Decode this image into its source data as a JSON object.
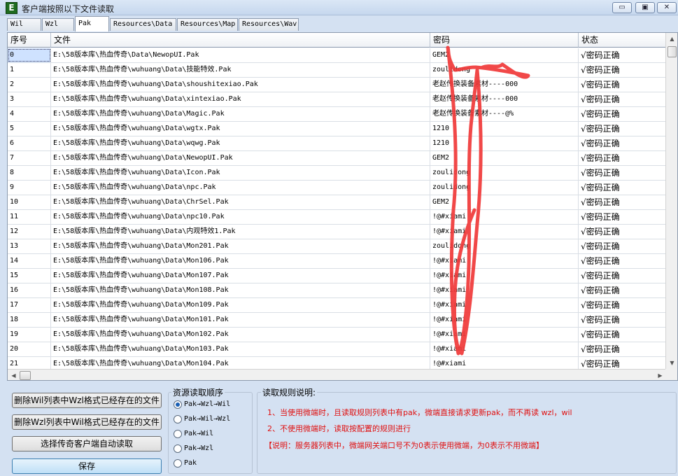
{
  "window": {
    "icon_letter": "E",
    "title": "客户端按照以下文件读取",
    "min_label": "▭",
    "max_label": "▣",
    "close_label": "✕"
  },
  "tabs": [
    {
      "label": "Wil",
      "active": false
    },
    {
      "label": "Wzl",
      "active": false
    },
    {
      "label": "Pak",
      "active": true
    },
    {
      "label": "Resources\\Data",
      "active": false
    },
    {
      "label": "Resources\\Map",
      "active": false
    },
    {
      "label": "Resources\\Wav",
      "active": false
    }
  ],
  "grid": {
    "headers": [
      "序号",
      "文件",
      "密码",
      "状态"
    ],
    "rows": [
      {
        "idx": "0",
        "file": "E:\\58版本库\\热血传奇\\Data\\NewopUI.Pak",
        "pwd": "GEM2",
        "status": "√密码正确"
      },
      {
        "idx": "1",
        "file": "E:\\58版本库\\热血传奇\\wuhuang\\Data\\技能特效.Pak",
        "pwd": "zoulidong",
        "status": "√密码正确"
      },
      {
        "idx": "2",
        "file": "E:\\58版本库\\热血传奇\\wuhuang\\Data\\shoushitexiao.Pak",
        "pwd": "老赵传换装备素材----000",
        "status": "√密码正确"
      },
      {
        "idx": "3",
        "file": "E:\\58版本库\\热血传奇\\wuhuang\\Data\\xintexiao.Pak",
        "pwd": "老赵传换装备素材----000",
        "status": "√密码正确"
      },
      {
        "idx": "4",
        "file": "E:\\58版本库\\热血传奇\\wuhuang\\Data\\Magic.Pak",
        "pwd": "老赵传换装备素材----@%",
        "status": "√密码正确"
      },
      {
        "idx": "5",
        "file": "E:\\58版本库\\热血传奇\\wuhuang\\Data\\wgtx.Pak",
        "pwd": "1210",
        "status": "√密码正确"
      },
      {
        "idx": "6",
        "file": "E:\\58版本库\\热血传奇\\wuhuang\\Data\\wqwg.Pak",
        "pwd": "1210",
        "status": "√密码正确"
      },
      {
        "idx": "7",
        "file": "E:\\58版本库\\热血传奇\\wuhuang\\Data\\NewopUI.Pak",
        "pwd": "GEM2",
        "status": "√密码正确"
      },
      {
        "idx": "8",
        "file": "E:\\58版本库\\热血传奇\\wuhuang\\Data\\Icon.Pak",
        "pwd": "zoulidong",
        "status": "√密码正确"
      },
      {
        "idx": "9",
        "file": "E:\\58版本库\\热血传奇\\wuhuang\\Data\\npc.Pak",
        "pwd": "zoulidong",
        "status": "√密码正确"
      },
      {
        "idx": "10",
        "file": "E:\\58版本库\\热血传奇\\wuhuang\\Data\\ChrSel.Pak",
        "pwd": "GEM2",
        "status": "√密码正确"
      },
      {
        "idx": "11",
        "file": "E:\\58版本库\\热血传奇\\wuhuang\\Data\\npc10.Pak",
        "pwd": "!@#xiami",
        "status": "√密码正确"
      },
      {
        "idx": "12",
        "file": "E:\\58版本库\\热血传奇\\wuhuang\\Data\\内观特效1.Pak",
        "pwd": "!@#xiami",
        "status": "√密码正确"
      },
      {
        "idx": "13",
        "file": "E:\\58版本库\\热血传奇\\wuhuang\\Data\\Mon201.Pak",
        "pwd": "zoulidong",
        "status": "√密码正确"
      },
      {
        "idx": "14",
        "file": "E:\\58版本库\\热血传奇\\wuhuang\\Data\\Mon106.Pak",
        "pwd": "!@#xiami",
        "status": "√密码正确"
      },
      {
        "idx": "15",
        "file": "E:\\58版本库\\热血传奇\\wuhuang\\Data\\Mon107.Pak",
        "pwd": "!@#xiami",
        "status": "√密码正确"
      },
      {
        "idx": "16",
        "file": "E:\\58版本库\\热血传奇\\wuhuang\\Data\\Mon108.Pak",
        "pwd": "!@#xiami",
        "status": "√密码正确"
      },
      {
        "idx": "17",
        "file": "E:\\58版本库\\热血传奇\\wuhuang\\Data\\Mon109.Pak",
        "pwd": "!@#xiami",
        "status": "√密码正确"
      },
      {
        "idx": "18",
        "file": "E:\\58版本库\\热血传奇\\wuhuang\\Data\\Mon101.Pak",
        "pwd": "!@#xiami",
        "status": "√密码正确"
      },
      {
        "idx": "19",
        "file": "E:\\58版本库\\热血传奇\\wuhuang\\Data\\Mon102.Pak",
        "pwd": "!@#xiami",
        "status": "√密码正确"
      },
      {
        "idx": "20",
        "file": "E:\\58版本库\\热血传奇\\wuhuang\\Data\\Mon103.Pak",
        "pwd": "!@#xiami",
        "status": "√密码正确"
      },
      {
        "idx": "21",
        "file": "E:\\58版本库\\热血传奇\\wuhuang\\Data\\Mon104.Pak",
        "pwd": "!@#xiami",
        "status": "√密码正确"
      }
    ]
  },
  "buttons": {
    "delete_wil": "删除Wil列表中Wzl格式已经存在的文件",
    "delete_wzl": "删除Wzl列表中Wil格式已经存在的文件",
    "auto_read": "选择传奇客户端自动读取",
    "save": "保存"
  },
  "order_group": {
    "title": "资源读取顺序",
    "options": [
      {
        "label": "Pak→Wzl→Wil",
        "selected": true
      },
      {
        "label": "Pak→Wil→Wzl",
        "selected": false
      },
      {
        "label": "Pak→Wil",
        "selected": false
      },
      {
        "label": "Pak→Wzl",
        "selected": false
      },
      {
        "label": "Pak",
        "selected": false
      }
    ]
  },
  "rules_group": {
    "title": "读取规则说明:",
    "line1": "1、当使用微端时，且读取规则列表中有pak，微端直接请求更新pak，而不再读 wzl，wil",
    "line2": "2、不使用微端时，读取按配置的规则进行",
    "note": "【说明：服务器列表中，微端网关端口号不为0表示使用微端，为0表示不用微端】"
  },
  "colors": {
    "rule_text": "#e01010",
    "scribble": "#f03838",
    "selected_cell": "#cfe2ff"
  }
}
